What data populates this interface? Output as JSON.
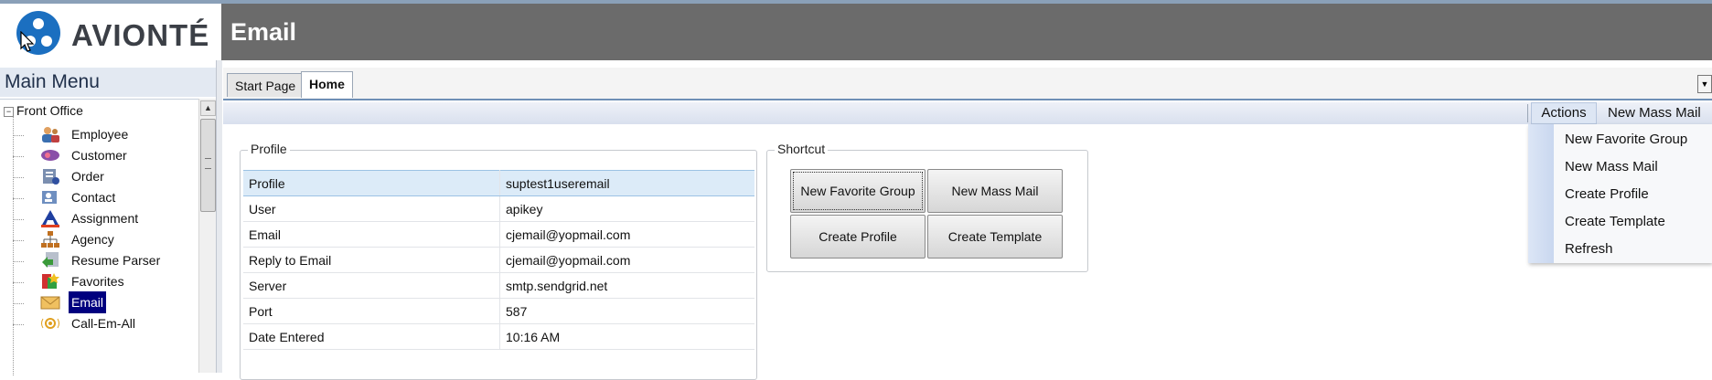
{
  "app": {
    "logo_text": "AVIONTÉ",
    "header_title": "Email"
  },
  "colors": {
    "brand_blue": "#1b6fc0",
    "header_gray": "#6b6b6b",
    "selection_navy": "#00007f",
    "accent_blue": "#6e8fb6"
  },
  "sidebar": {
    "title": "Main Menu",
    "root": {
      "label": "Front Office",
      "expander": "⊟"
    },
    "items": [
      {
        "label": "Employee",
        "icon": "employee-icon"
      },
      {
        "label": "Customer",
        "icon": "customer-icon"
      },
      {
        "label": "Order",
        "icon": "order-icon"
      },
      {
        "label": "Contact",
        "icon": "contact-icon"
      },
      {
        "label": "Assignment",
        "icon": "assignment-icon"
      },
      {
        "label": "Agency",
        "icon": "agency-icon"
      },
      {
        "label": "Resume Parser",
        "icon": "resume-parser-icon"
      },
      {
        "label": "Favorites",
        "icon": "favorites-icon"
      },
      {
        "label": "Email",
        "icon": "email-icon",
        "selected": true
      },
      {
        "label": "Call-Em-All",
        "icon": "call-em-all-icon"
      }
    ]
  },
  "tabs": [
    {
      "label": "Start Page"
    },
    {
      "label": "Home",
      "active": true
    }
  ],
  "toolbar": {
    "actions_label": "Actions",
    "new_mass_mail_label": "New Mass Mail"
  },
  "profile": {
    "group_title": "Profile",
    "rows": [
      {
        "key": "Profile",
        "value": "suptest1useremail"
      },
      {
        "key": "User",
        "value": "apikey"
      },
      {
        "key": "Email",
        "value": "cjemail@yopmail.com"
      },
      {
        "key": "Reply to Email",
        "value": "cjemail@yopmail.com"
      },
      {
        "key": "Server",
        "value": "smtp.sendgrid.net"
      },
      {
        "key": "Port",
        "value": "587"
      },
      {
        "key": "Date Entered",
        "value": "10:16 AM"
      }
    ]
  },
  "shortcut": {
    "group_title": "Shortcut",
    "buttons": [
      {
        "label": "New Favorite Group"
      },
      {
        "label": "New Mass Mail"
      },
      {
        "label": "Create Profile"
      },
      {
        "label": "Create Template"
      }
    ]
  },
  "actions_menu": {
    "items": [
      {
        "label": "New Favorite Group"
      },
      {
        "label": "New Mass Mail"
      },
      {
        "label": "Create Profile"
      },
      {
        "label": "Create Template"
      },
      {
        "label": "Refresh"
      }
    ]
  }
}
